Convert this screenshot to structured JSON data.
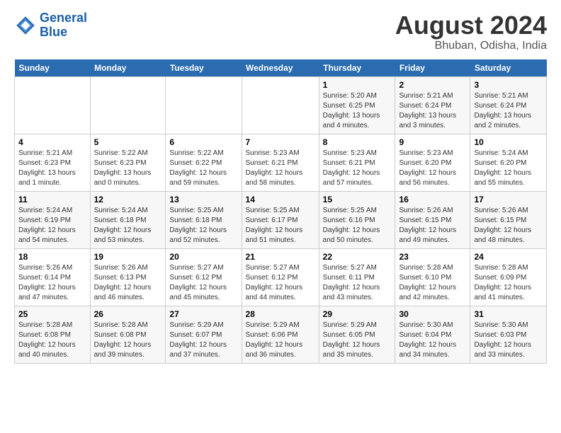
{
  "header": {
    "logo_line1": "General",
    "logo_line2": "Blue",
    "title": "August 2024",
    "subtitle": "Bhuban, Odisha, India"
  },
  "calendar": {
    "days_of_week": [
      "Sunday",
      "Monday",
      "Tuesday",
      "Wednesday",
      "Thursday",
      "Friday",
      "Saturday"
    ],
    "weeks": [
      [
        {
          "day": "",
          "info": ""
        },
        {
          "day": "",
          "info": ""
        },
        {
          "day": "",
          "info": ""
        },
        {
          "day": "",
          "info": ""
        },
        {
          "day": "1",
          "info": "Sunrise: 5:20 AM\nSunset: 6:25 PM\nDaylight: 13 hours\nand 4 minutes."
        },
        {
          "day": "2",
          "info": "Sunrise: 5:21 AM\nSunset: 6:24 PM\nDaylight: 13 hours\nand 3 minutes."
        },
        {
          "day": "3",
          "info": "Sunrise: 5:21 AM\nSunset: 6:24 PM\nDaylight: 13 hours\nand 2 minutes."
        }
      ],
      [
        {
          "day": "4",
          "info": "Sunrise: 5:21 AM\nSunset: 6:23 PM\nDaylight: 13 hours\nand 1 minute."
        },
        {
          "day": "5",
          "info": "Sunrise: 5:22 AM\nSunset: 6:23 PM\nDaylight: 13 hours\nand 0 minutes."
        },
        {
          "day": "6",
          "info": "Sunrise: 5:22 AM\nSunset: 6:22 PM\nDaylight: 12 hours\nand 59 minutes."
        },
        {
          "day": "7",
          "info": "Sunrise: 5:23 AM\nSunset: 6:21 PM\nDaylight: 12 hours\nand 58 minutes."
        },
        {
          "day": "8",
          "info": "Sunrise: 5:23 AM\nSunset: 6:21 PM\nDaylight: 12 hours\nand 57 minutes."
        },
        {
          "day": "9",
          "info": "Sunrise: 5:23 AM\nSunset: 6:20 PM\nDaylight: 12 hours\nand 56 minutes."
        },
        {
          "day": "10",
          "info": "Sunrise: 5:24 AM\nSunset: 6:20 PM\nDaylight: 12 hours\nand 55 minutes."
        }
      ],
      [
        {
          "day": "11",
          "info": "Sunrise: 5:24 AM\nSunset: 6:19 PM\nDaylight: 12 hours\nand 54 minutes."
        },
        {
          "day": "12",
          "info": "Sunrise: 5:24 AM\nSunset: 6:18 PM\nDaylight: 12 hours\nand 53 minutes."
        },
        {
          "day": "13",
          "info": "Sunrise: 5:25 AM\nSunset: 6:18 PM\nDaylight: 12 hours\nand 52 minutes."
        },
        {
          "day": "14",
          "info": "Sunrise: 5:25 AM\nSunset: 6:17 PM\nDaylight: 12 hours\nand 51 minutes."
        },
        {
          "day": "15",
          "info": "Sunrise: 5:25 AM\nSunset: 6:16 PM\nDaylight: 12 hours\nand 50 minutes."
        },
        {
          "day": "16",
          "info": "Sunrise: 5:26 AM\nSunset: 6:15 PM\nDaylight: 12 hours\nand 49 minutes."
        },
        {
          "day": "17",
          "info": "Sunrise: 5:26 AM\nSunset: 6:15 PM\nDaylight: 12 hours\nand 48 minutes."
        }
      ],
      [
        {
          "day": "18",
          "info": "Sunrise: 5:26 AM\nSunset: 6:14 PM\nDaylight: 12 hours\nand 47 minutes."
        },
        {
          "day": "19",
          "info": "Sunrise: 5:26 AM\nSunset: 6:13 PM\nDaylight: 12 hours\nand 46 minutes."
        },
        {
          "day": "20",
          "info": "Sunrise: 5:27 AM\nSunset: 6:12 PM\nDaylight: 12 hours\nand 45 minutes."
        },
        {
          "day": "21",
          "info": "Sunrise: 5:27 AM\nSunset: 6:12 PM\nDaylight: 12 hours\nand 44 minutes."
        },
        {
          "day": "22",
          "info": "Sunrise: 5:27 AM\nSunset: 6:11 PM\nDaylight: 12 hours\nand 43 minutes."
        },
        {
          "day": "23",
          "info": "Sunrise: 5:28 AM\nSunset: 6:10 PM\nDaylight: 12 hours\nand 42 minutes."
        },
        {
          "day": "24",
          "info": "Sunrise: 5:28 AM\nSunset: 6:09 PM\nDaylight: 12 hours\nand 41 minutes."
        }
      ],
      [
        {
          "day": "25",
          "info": "Sunrise: 5:28 AM\nSunset: 6:08 PM\nDaylight: 12 hours\nand 40 minutes."
        },
        {
          "day": "26",
          "info": "Sunrise: 5:28 AM\nSunset: 6:08 PM\nDaylight: 12 hours\nand 39 minutes."
        },
        {
          "day": "27",
          "info": "Sunrise: 5:29 AM\nSunset: 6:07 PM\nDaylight: 12 hours\nand 37 minutes."
        },
        {
          "day": "28",
          "info": "Sunrise: 5:29 AM\nSunset: 6:06 PM\nDaylight: 12 hours\nand 36 minutes."
        },
        {
          "day": "29",
          "info": "Sunrise: 5:29 AM\nSunset: 6:05 PM\nDaylight: 12 hours\nand 35 minutes."
        },
        {
          "day": "30",
          "info": "Sunrise: 5:30 AM\nSunset: 6:04 PM\nDaylight: 12 hours\nand 34 minutes."
        },
        {
          "day": "31",
          "info": "Sunrise: 5:30 AM\nSunset: 6:03 PM\nDaylight: 12 hours\nand 33 minutes."
        }
      ]
    ]
  }
}
